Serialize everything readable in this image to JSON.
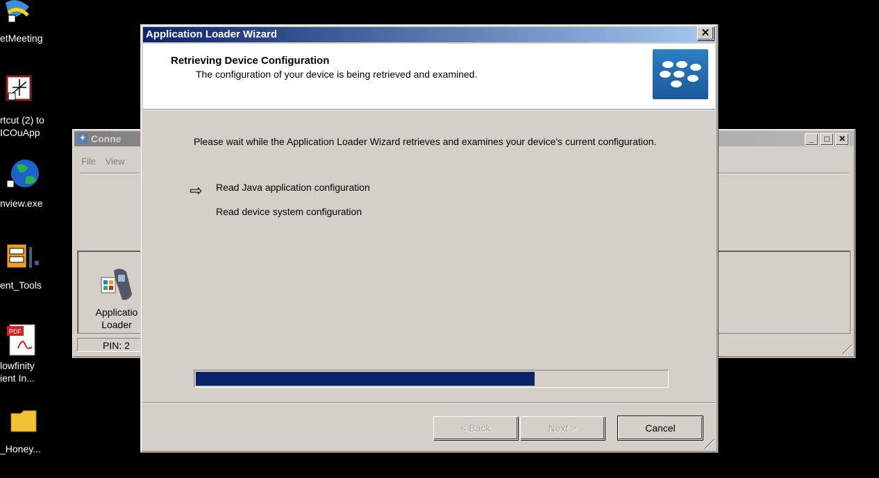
{
  "desktop": {
    "icons": [
      {
        "label": "etMeeting",
        "icon": "netmeeting-icon"
      },
      {
        "label_lines": [
          "rtcut (2) to",
          "ICOuApp"
        ],
        "icon": "shortcut-app-icon"
      },
      {
        "label": "nview.exe",
        "icon": "globe-icon"
      },
      {
        "label": "ent_Tools",
        "icon": "tools-cabinet-icon"
      },
      {
        "label_lines": [
          "lowfinity",
          "ient In..."
        ],
        "icon": "pdf-icon"
      },
      {
        "label": "_Honey...",
        "icon": "folder-icon"
      }
    ]
  },
  "bg_window": {
    "title": "Conne",
    "menu": [
      "File",
      "View"
    ],
    "app_label_lines": [
      "Applicatio",
      "Loader"
    ],
    "status_pin": "PIN: 2"
  },
  "wizard": {
    "title": "Application Loader Wizard",
    "header_title": "Retrieving Device Configuration",
    "header_subtitle": "The configuration of your device is being retrieved and examined.",
    "body_text": "Please wait while the Application Loader Wizard retrieves and examines your device's current configuration.",
    "steps": [
      {
        "label": "Read Java application configuration",
        "current": true
      },
      {
        "label": "Read device system configuration",
        "current": false
      }
    ],
    "progress_percent": 72,
    "buttons": {
      "back": "< Back",
      "next": "Next >",
      "cancel": "Cancel"
    },
    "colors": {
      "progress": "#0a246a",
      "titlebar": "#0a246a"
    }
  }
}
